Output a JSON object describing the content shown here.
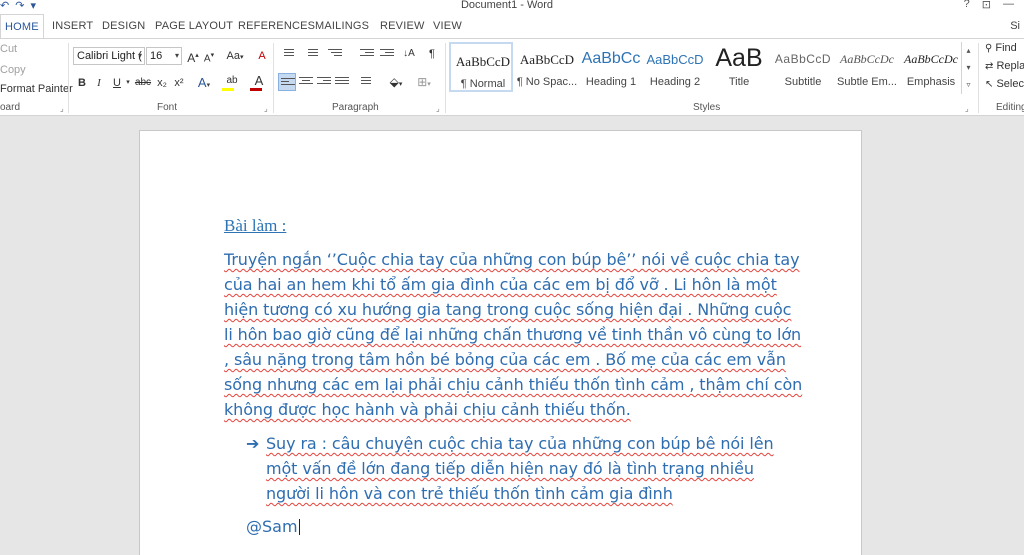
{
  "window": {
    "title": "Document1 - Word",
    "qat": [
      "↶",
      "↷",
      "▾"
    ],
    "controls": [
      "?",
      "⊡",
      "—"
    ]
  },
  "tabs": [
    "HOME",
    "INSERT",
    "DESIGN",
    "PAGE LAYOUT",
    "REFERENCES",
    "MAILINGS",
    "REVIEW",
    "VIEW"
  ],
  "active_tab": "HOME",
  "user_short": "Si",
  "clipboard": {
    "cut": "Cut",
    "copy": "Copy",
    "format_painter": "Format Painter",
    "group_label": "oard"
  },
  "font": {
    "family": "Calibri Light (",
    "size": "16",
    "grow": "A",
    "shrink": "A",
    "change_case": "Aa",
    "clear": "A",
    "bold": "B",
    "italic": "I",
    "underline": "U",
    "strike": "abc",
    "subscript": "x₂",
    "superscript": "x²",
    "effects": "A",
    "highlight": "ab",
    "color": "A",
    "group_label": "Font"
  },
  "paragraph": {
    "group_label": "Paragraph",
    "pilcrow": "¶"
  },
  "styles": {
    "group_label": "Styles",
    "items": [
      {
        "sample": "AaBbCcD",
        "label": "¶ Normal"
      },
      {
        "sample": "AaBbCcD",
        "label": "¶ No Spac..."
      },
      {
        "sample": "AaBbCc",
        "label": "Heading 1"
      },
      {
        "sample": "AaBbCcD",
        "label": "Heading 2"
      },
      {
        "sample": "AaB",
        "label": "Title"
      },
      {
        "sample": "AaBbCcD",
        "label": "Subtitle"
      },
      {
        "sample": "AaBbCcDc",
        "label": "Subtle Em..."
      },
      {
        "sample": "AaBbCcDc",
        "label": "Emphasis"
      }
    ]
  },
  "editing": {
    "find": "Find",
    "replace": "Replac",
    "select": "Select",
    "group_label": "Editing"
  },
  "document": {
    "heading": "Bài làm :",
    "paragraph_lines": [
      "Truyện ngắn ‘’Cuộc chia tay của những con búp bê’’ nói về cuộc chia tay",
      "của hai an hem khi tổ ấm gia đình của các em bị đổ vỡ .  Li hôn là một",
      "hiện tương có xu hướng gia tang trong cuộc sống hiện đại . Những cuộc",
      "li hôn bao giờ cũng để lại những chấn thương về tinh thần vô cùng to lớn",
      ", sâu nặng trong tâm hồn bé bỏng của các em . Bố mẹ của các em vẫn",
      "sống nhưng các em lại phải chịu cảnh thiếu thốn tình cảm , thậm chí còn",
      "không được học hành và phải chịu cảnh thiếu thốn."
    ],
    "arrow": "➔",
    "bullet_lines": [
      "Suy ra : câu chuyện cuộc chia tay của những con  búp bê nói lên",
      "một vấn đề lớn đang tiếp diễn hiện nay đó là tình trạng nhiều",
      "người li hôn và con trẻ thiếu thốn tình cảm gia đình"
    ],
    "signature": "@Sam"
  }
}
